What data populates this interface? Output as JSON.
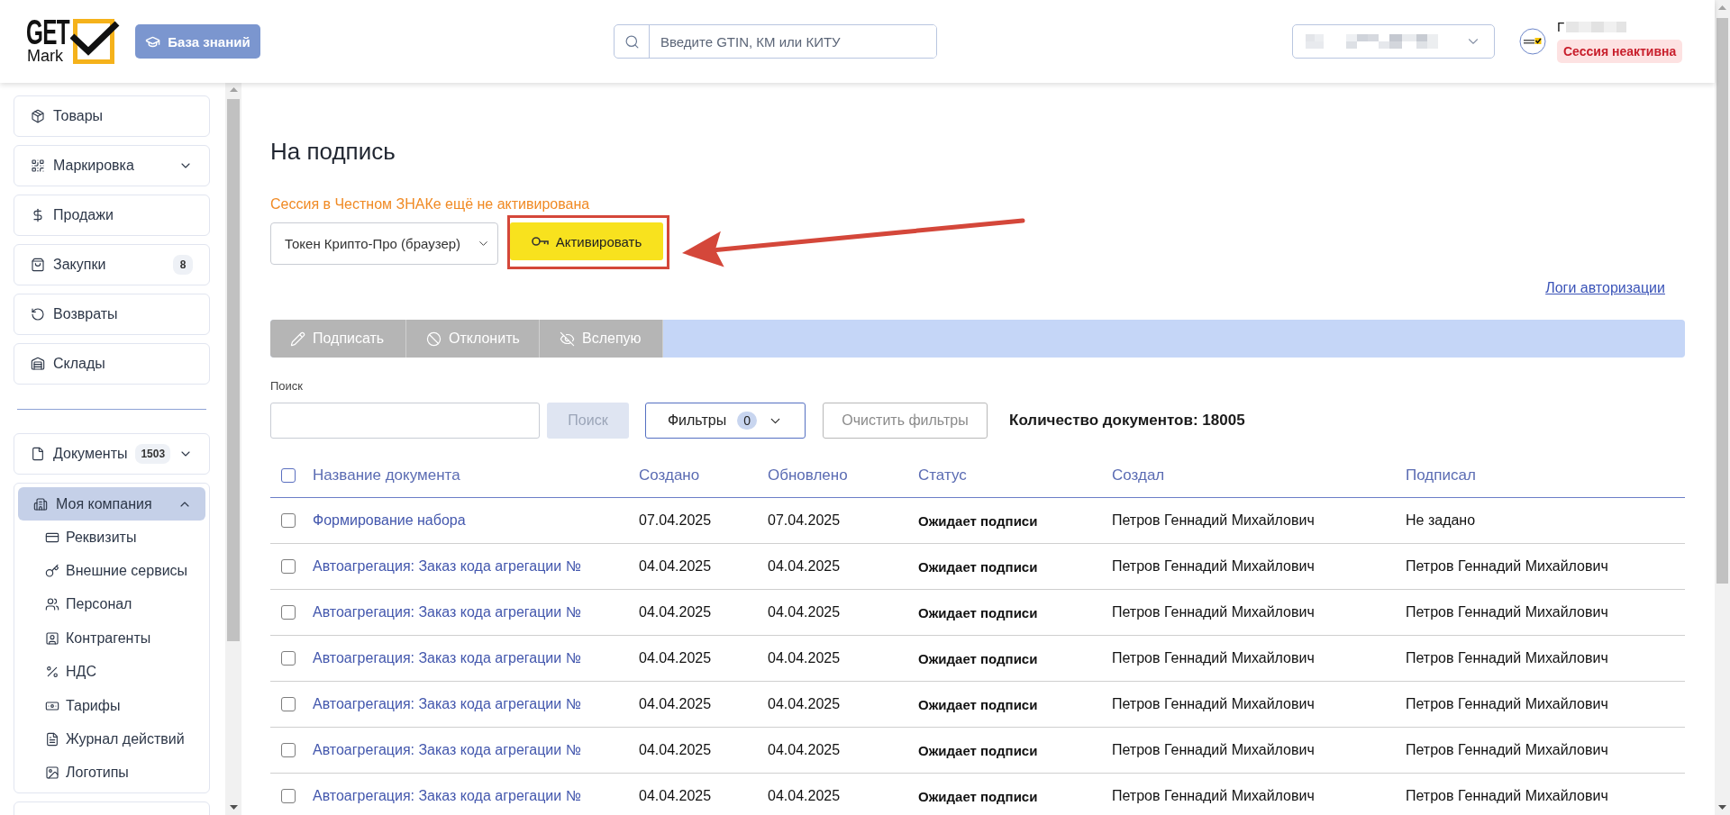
{
  "header": {
    "logo": {
      "line_1": "GET",
      "line_2": "Mark"
    },
    "knowledge_button": {
      "label": "База знаний"
    },
    "search": {
      "placeholder": "Введите GTIN, КМ или КИТУ"
    },
    "user": {
      "name": "Г",
      "session_badge": "Сессия неактивна"
    }
  },
  "sidebar": {
    "main_items": [
      {
        "label": "Товары",
        "selected": false
      },
      {
        "label": "Маркировка",
        "selected": false,
        "expanded": false
      },
      {
        "label": "Продажи",
        "selected": false
      },
      {
        "label": "Закупки",
        "selected": false,
        "badge": "8"
      },
      {
        "label": "Возвраты",
        "selected": false
      },
      {
        "label": "Склады",
        "selected": false
      }
    ],
    "section_items": [
      {
        "label": "Документы",
        "selected": false,
        "badge": "1503",
        "expanded": false
      },
      {
        "label": "Моя компания",
        "selected": true,
        "expanded": true,
        "children": [
          {
            "label": "Реквизиты",
            "selected": false
          },
          {
            "label": "Внешние сервисы",
            "selected": false
          },
          {
            "label": "Персонал",
            "selected": false
          },
          {
            "label": "Контрагенты",
            "selected": false
          },
          {
            "label": "НДС",
            "selected": false
          },
          {
            "label": "Тарифы",
            "selected": false
          },
          {
            "label": "Журнал действий",
            "selected": false
          },
          {
            "label": "Логотипы",
            "selected": false
          }
        ]
      },
      {
        "selected": false
      }
    ]
  },
  "page": {
    "title": "На подпись",
    "session_warning": "Сессия в Честном ЗНАКе ещё не активирована",
    "token_select": {
      "value": "Токен Крипто-Про (браузер)"
    },
    "activate_button": {
      "label": "Активировать"
    },
    "auth_logs_link": "Логи авторизации",
    "actions": [
      {
        "label": "Подписать",
        "disabled": true
      },
      {
        "label": "Отклонить",
        "disabled": true
      },
      {
        "label": "Вслепую",
        "disabled": true
      }
    ],
    "search": {
      "label": "Поиск",
      "button": {
        "label": "Поиск",
        "disabled": true
      }
    },
    "filters_button": {
      "label": "Фильтры",
      "count": "0"
    },
    "clear_filters_button": {
      "label": "Очистить фильтры",
      "disabled": true
    },
    "documents_count": "Количество документов: 18005"
  },
  "table": {
    "all_checked": false,
    "columns": [
      {
        "label": "Название документа",
        "kind": "link"
      },
      {
        "label": "Создано",
        "kind": "text"
      },
      {
        "label": "Обновлено",
        "kind": "text"
      },
      {
        "label": "Статус",
        "kind": "status"
      },
      {
        "label": "Создал",
        "kind": "text"
      },
      {
        "label": "Подписал",
        "kind": "text"
      }
    ],
    "rows": [
      {
        "checked": false,
        "cells": [
          "Формирование набора",
          "07.04.2025",
          "07.04.2025",
          "Ожидает подписи",
          "Петров Геннадий Михайлович",
          "Не задано"
        ]
      },
      {
        "checked": false,
        "cells": [
          "Автоагрегация: Заказ кода агрегации №",
          "04.04.2025",
          "04.04.2025",
          "Ожидает подписи",
          "Петров Геннадий Михайлович",
          "Петров Геннадий Михайлович"
        ]
      },
      {
        "checked": false,
        "cells": [
          "Автоагрегация: Заказ кода агрегации №",
          "04.04.2025",
          "04.04.2025",
          "Ожидает подписи",
          "Петров Геннадий Михайлович",
          "Петров Геннадий Михайлович"
        ]
      },
      {
        "checked": false,
        "cells": [
          "Автоагрегация: Заказ кода агрегации №",
          "04.04.2025",
          "04.04.2025",
          "Ожидает подписи",
          "Петров Геннадий Михайлович",
          "Петров Геннадий Михайлович"
        ]
      },
      {
        "checked": false,
        "cells": [
          "Автоагрегация: Заказ кода агрегации №",
          "04.04.2025",
          "04.04.2025",
          "Ожидает подписи",
          "Петров Геннадий Михайлович",
          "Петров Геннадий Михайлович"
        ]
      },
      {
        "checked": false,
        "cells": [
          "Автоагрегация: Заказ кода агрегации №",
          "04.04.2025",
          "04.04.2025",
          "Ожидает подписи",
          "Петров Геннадий Михайлович",
          "Петров Геннадий Михайлович"
        ]
      },
      {
        "checked": false,
        "cells": [
          "Автоагрегация: Заказ кода агрегации №",
          "04.04.2025",
          "04.04.2025",
          "Ожидает подписи",
          "Петров Геннадий Михайлович",
          "Петров Геннадий Михайлович"
        ]
      }
    ]
  }
}
